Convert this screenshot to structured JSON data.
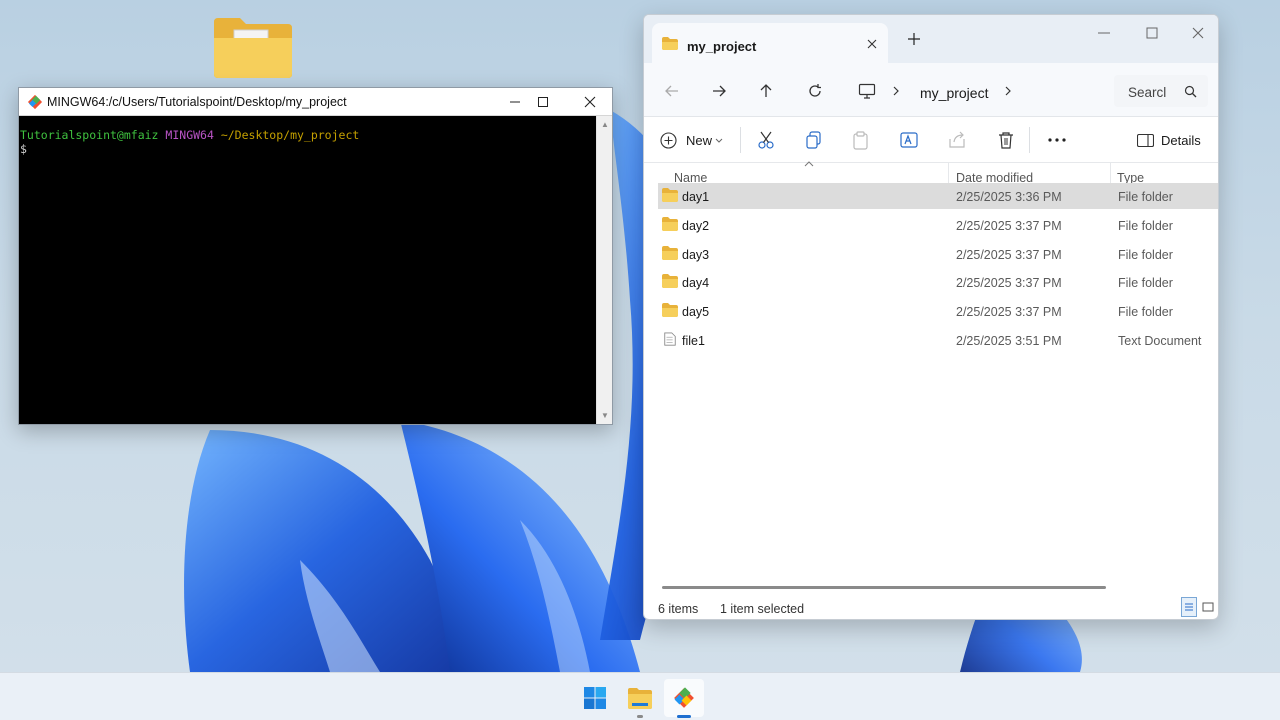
{
  "terminal": {
    "title": "MINGW64:/c/Users/Tutorialspoint/Desktop/my_project",
    "prompt_user": "Tutorialspoint@mfaiz",
    "prompt_host": "MINGW64",
    "prompt_path": "~/Desktop/my_project",
    "prompt_symbol": "$"
  },
  "explorer": {
    "tab_title": "my_project",
    "address": "my_project",
    "search_placeholder": "Searcl",
    "toolbar": {
      "new_label": "New",
      "details_label": "Details"
    },
    "columns": [
      "Name",
      "Date modified",
      "Type"
    ],
    "rows": [
      {
        "name": "day1",
        "date": "2/25/2025 3:36 PM",
        "type": "File folder",
        "icon": "folder-icon",
        "selected": true
      },
      {
        "name": "day2",
        "date": "2/25/2025 3:37 PM",
        "type": "File folder",
        "icon": "folder-icon",
        "selected": false
      },
      {
        "name": "day3",
        "date": "2/25/2025 3:37 PM",
        "type": "File folder",
        "icon": "folder-icon",
        "selected": false
      },
      {
        "name": "day4",
        "date": "2/25/2025 3:37 PM",
        "type": "File folder",
        "icon": "folder-icon",
        "selected": false
      },
      {
        "name": "day5",
        "date": "2/25/2025 3:37 PM",
        "type": "File folder",
        "icon": "folder-icon",
        "selected": false
      },
      {
        "name": "file1",
        "date": "2/25/2025 3:51 PM",
        "type": "Text Document",
        "icon": "text-file-icon",
        "selected": false
      }
    ],
    "status": {
      "item_count": "6 items",
      "selection": "1 item selected"
    }
  },
  "taskbar": {
    "items": [
      "windows-start-icon",
      "file-explorer-icon",
      "git-bash-icon"
    ]
  },
  "colors": {
    "folder": "#f2c94c",
    "selection": "#dcdcdc",
    "wallpaper_blue": "#1f5fe0",
    "terminal_green": "#3fc13f",
    "terminal_magenta": "#b954c6",
    "terminal_yellow": "#c4a000"
  }
}
